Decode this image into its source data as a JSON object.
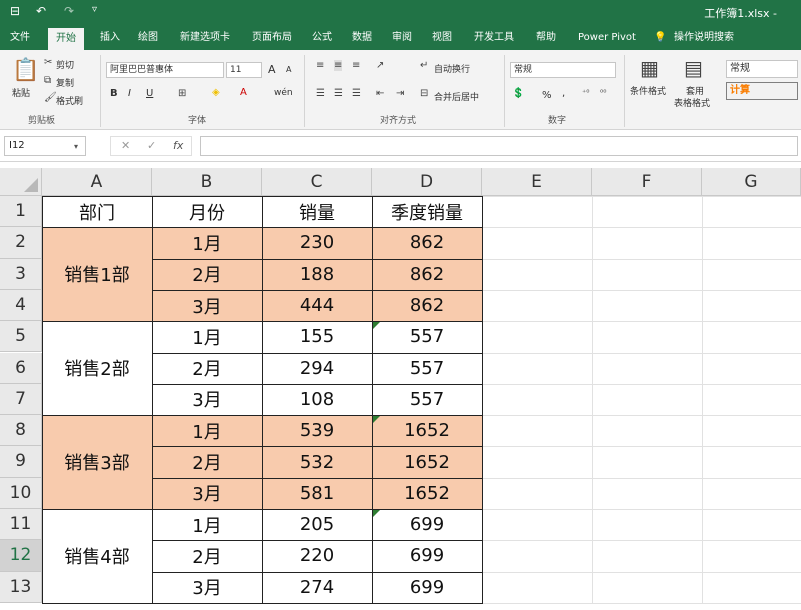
{
  "window": {
    "title": "工作簿1.xlsx - ",
    "qa_save": "⊟",
    "qa_undo": "↶",
    "qa_redo": "↷",
    "qa_customize": "▿"
  },
  "tabs": [
    "文件",
    "开始",
    "插入",
    "绘图",
    "新建选项卡",
    "页面布局",
    "公式",
    "数据",
    "审阅",
    "视图",
    "开发工具",
    "帮助",
    "Power Pivot",
    "操作说明搜索"
  ],
  "ribbon": {
    "clipboard": {
      "paste": "粘贴",
      "cut": "剪切",
      "copy": "复制",
      "format_painter": "格式刷",
      "label": "剪贴板"
    },
    "font": {
      "name": "阿里巴巴普惠体",
      "size": "11",
      "bold": "B",
      "italic": "I",
      "underline": "U",
      "grow": "A",
      "shrink": "A",
      "phonetic": "wén",
      "label": "字体"
    },
    "alignment": {
      "wrap": "自动换行",
      "merge": "合并后居中",
      "label": "对齐方式"
    },
    "number": {
      "format": "常规",
      "percent": "%",
      "comma": ",",
      "label": "数字"
    },
    "styles": {
      "conditional": "条件格式",
      "table_format_1": "套用",
      "table_format_2": "表格格式",
      "style_normal": "常规",
      "style_calc": "计算"
    }
  },
  "formula_bar": {
    "name_box": "I12",
    "cancel": "✕",
    "confirm": "✓",
    "fx": "fx",
    "value": ""
  },
  "columns": [
    "A",
    "B",
    "C",
    "D",
    "E",
    "F",
    "G"
  ],
  "rows": [
    "1",
    "2",
    "3",
    "4",
    "5",
    "6",
    "7",
    "8",
    "9",
    "10",
    "11",
    "12",
    "13"
  ],
  "selected_row": "12",
  "accent_color": "#217346",
  "fill_color": "#f8cbad",
  "table": {
    "headers": [
      "部门",
      "月份",
      "销量",
      "季度销量"
    ],
    "groups": [
      {
        "dept": "销售1部",
        "fill": "orange",
        "months": [
          "1月",
          "2月",
          "3月"
        ],
        "sales": [
          "230",
          "188",
          "444"
        ],
        "quarter": [
          "862",
          "862",
          "862"
        ]
      },
      {
        "dept": "销售2部",
        "fill": "white",
        "months": [
          "1月",
          "2月",
          "3月"
        ],
        "sales": [
          "155",
          "294",
          "108"
        ],
        "quarter": [
          "557",
          "557",
          "557"
        ]
      },
      {
        "dept": "销售3部",
        "fill": "orange",
        "months": [
          "1月",
          "2月",
          "3月"
        ],
        "sales": [
          "539",
          "532",
          "581"
        ],
        "quarter": [
          "1652",
          "1652",
          "1652"
        ]
      },
      {
        "dept": "销售4部",
        "fill": "white",
        "months": [
          "1月",
          "2月",
          "3月"
        ],
        "sales": [
          "205",
          "220",
          "274"
        ],
        "quarter": [
          "699",
          "699",
          "699"
        ]
      }
    ]
  }
}
